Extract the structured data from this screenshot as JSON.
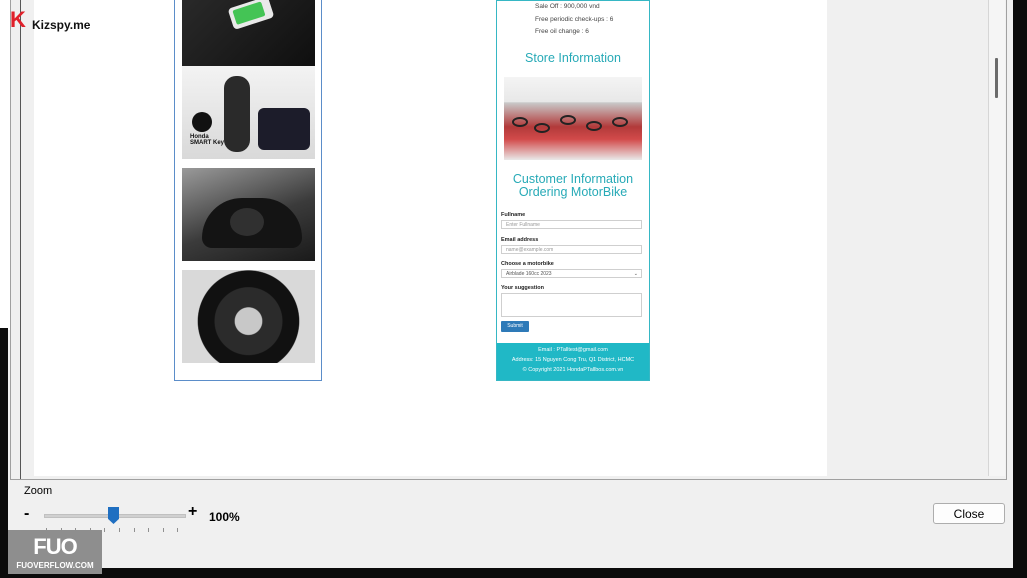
{
  "watermark": {
    "logo_k": "K",
    "logo_text": "Kizspy.me",
    "bottom_big": "FUO",
    "bottom_small": "FUOVERFLOW.COM"
  },
  "left_preview": {
    "smart_key_label": "Honda SMART Key"
  },
  "right_preview": {
    "promo_lines": [
      "Sale Off : 900,000 vnd",
      "Free periodic check-ups : 6",
      "Free oil change : 6"
    ],
    "store_title": "Store Information",
    "customer_title": "Customer Information Ordering MotorBike",
    "form": {
      "fullname_label": "Fullname",
      "fullname_placeholder": "Enter Fullname",
      "email_label": "Email address",
      "email_placeholder": "name@example.com",
      "motorbike_label": "Choose a motorbike",
      "motorbike_value": "Airblade 160cc 2023",
      "suggestion_label": "Your suggestion",
      "submit_label": "Submit"
    },
    "footer": {
      "email": "Email : PTalltest@gmail.com",
      "address": "Address: 15 Nguyen Cong Tru, Q1 District, HCMC",
      "copyright": "© Copyright 2021 HondaPTallbos.com.vn"
    }
  },
  "zoom": {
    "label": "Zoom",
    "minus": "-",
    "plus": "+",
    "value_text": "100%",
    "level_percent": 100
  },
  "close_label": "Close",
  "colors": {
    "accent_teal": "#27aab7",
    "slider_blue": "#1f6fc1",
    "logo_red": "#e0202a"
  }
}
